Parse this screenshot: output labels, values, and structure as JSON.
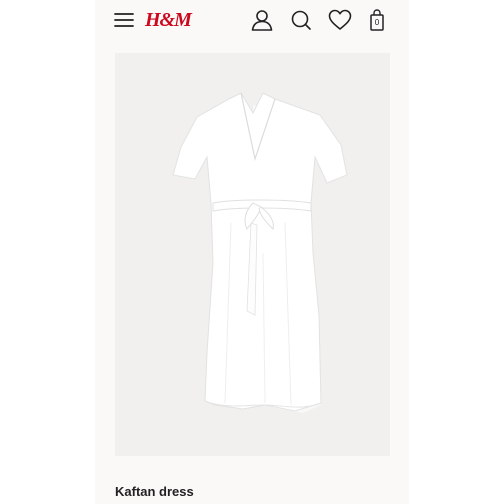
{
  "header": {
    "logo_text": "H&M",
    "icons": {
      "menu": "menu-icon",
      "account": "account-icon",
      "search": "search-icon",
      "favourites": "heart-icon",
      "bag": "shopping-bag-icon"
    },
    "bag_count": "0"
  },
  "product": {
    "title": "Kaftan dress",
    "image_alt": "white kaftan dress"
  },
  "colors": {
    "brand": "#cc071e",
    "page_background": "#faf9f8",
    "image_background": "#f1f0ef"
  }
}
